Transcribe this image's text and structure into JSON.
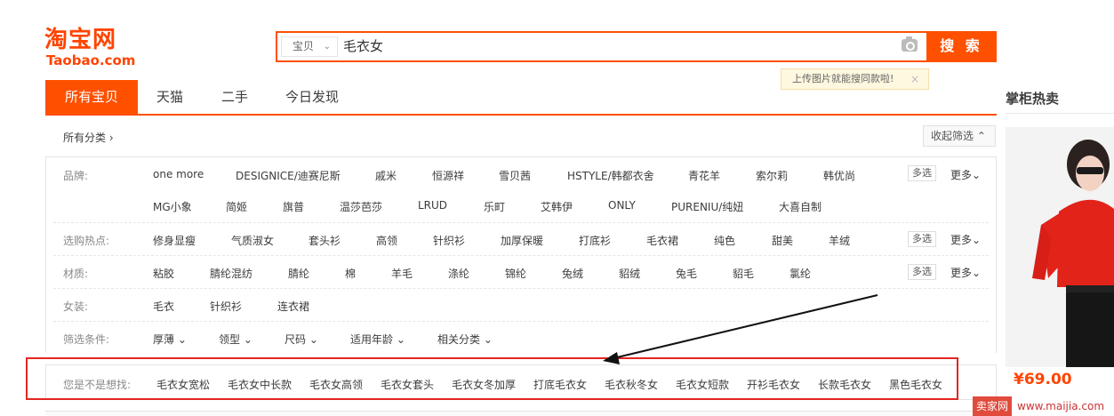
{
  "logo": {
    "cn": "淘宝网",
    "en": "Taobao.com"
  },
  "search": {
    "type": "宝贝",
    "value": "毛衣女",
    "button": "搜 索",
    "tip": "上传图片就能搜同款啦!",
    "tip_close": "×"
  },
  "tabs": [
    "所有宝贝",
    "天猫",
    "二手",
    "今日发现"
  ],
  "side": {
    "title": "掌柜热卖",
    "price": "¥69.00"
  },
  "filters": {
    "all_categories": "所有分类 ›",
    "collapse": "收起筛选 ⌃",
    "multi_label": "多选",
    "more_label": "更多⌄",
    "rows": [
      {
        "label": "品牌:",
        "items": [
          "one more",
          "DESIGNICE/迪赛尼斯",
          "戚米",
          "恒源祥",
          "雪贝茜",
          "HSTYLE/韩都衣舍",
          "青花羊",
          "索尔莉",
          "韩优尚"
        ],
        "items2": [
          "MG小象",
          "简姬",
          "旗普",
          "温莎芭莎",
          "LRUD",
          "乐町",
          "艾韩伊",
          "ONLY",
          "PURENIU/纯妞",
          "大喜自制"
        ]
      },
      {
        "label": "选购热点:",
        "items": [
          "修身显瘦",
          "气质淑女",
          "套头衫",
          "高领",
          "针织衫",
          "加厚保暖",
          "打底衫",
          "毛衣裙",
          "纯色",
          "甜美",
          "羊绒"
        ]
      },
      {
        "label": "材质:",
        "items": [
          "粘胶",
          "腈纶混纺",
          "腈纶",
          "棉",
          "羊毛",
          "涤纶",
          "锦纶",
          "兔绒",
          "貂绒",
          "兔毛",
          "貂毛",
          "氯纶"
        ]
      },
      {
        "label": "女装:",
        "items": [
          "毛衣",
          "针织衫",
          "连衣裙"
        ]
      },
      {
        "label": "筛选条件:",
        "items": [
          "厚薄 ⌄",
          "领型 ⌄",
          "尺码 ⌄",
          "适用年龄 ⌄",
          "相关分类 ⌄"
        ]
      }
    ]
  },
  "suggestions": {
    "label": "您是不是想找:",
    "items": [
      "毛衣女宽松",
      "毛衣女中长款",
      "毛衣女高领",
      "毛衣女套头",
      "毛衣女冬加厚",
      "打底毛衣女",
      "毛衣秋冬女",
      "毛衣女短款",
      "开衫毛衣女",
      "长款毛衣女",
      "黑色毛衣女"
    ]
  },
  "watermark": {
    "badge": "卖家网",
    "url": "www.maijia.com"
  }
}
